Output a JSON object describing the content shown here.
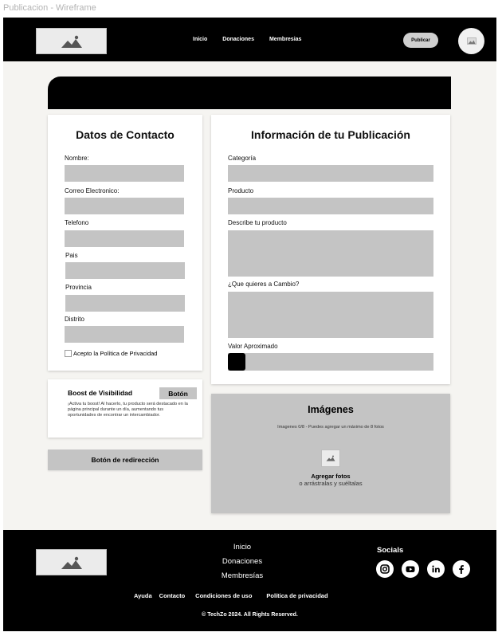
{
  "frame_title": "Publicacion - Wireframe",
  "header": {
    "nav": [
      "Inicio",
      "Donaciones",
      "Membresias"
    ],
    "publish_button": "Publicar"
  },
  "contact": {
    "title": "Datos de Contacto",
    "fields": [
      "Nombre:",
      "Correo Electronico:",
      "Telefono",
      "Pais",
      "Provincia",
      "Distrito"
    ],
    "privacy": "Acepto la Política de Privacidad"
  },
  "publication": {
    "title": "Información de tu Publicación",
    "category": "Categoría",
    "product": "Producto",
    "describe": "Describe tu producto",
    "exchange": "¿Que quieres a Cambio?",
    "value": "Valor Aproximado"
  },
  "boost": {
    "title": "Boost de Visibilidad",
    "button": "Botón",
    "description": "¡Activa tu boost! Al hacerlo, tu producto será destacado en la página principal durante un día, aumentando tus oportunidades de encontrar un intercambiador."
  },
  "redirect_button": "Botón de redirección",
  "images": {
    "title": "Imágenes",
    "hint": "Imagenes 0/8 - Puedes agregar un máximo de 8 fotos",
    "add": "Agregar fotos",
    "drag": "o arrástralas y suéltalas"
  },
  "footer": {
    "nav": [
      "Inicio",
      "Donaciones",
      "Membresías"
    ],
    "socials_title": "Socials",
    "socials": [
      "instagram-icon",
      "youtube-icon",
      "linkedin-icon",
      "facebook-icon"
    ],
    "links": [
      "Ayuda",
      "Contacto",
      "Condiciones de uso",
      "Política de privacidad"
    ],
    "copyright": "© TechZo 2024. All Rights Reserved."
  }
}
